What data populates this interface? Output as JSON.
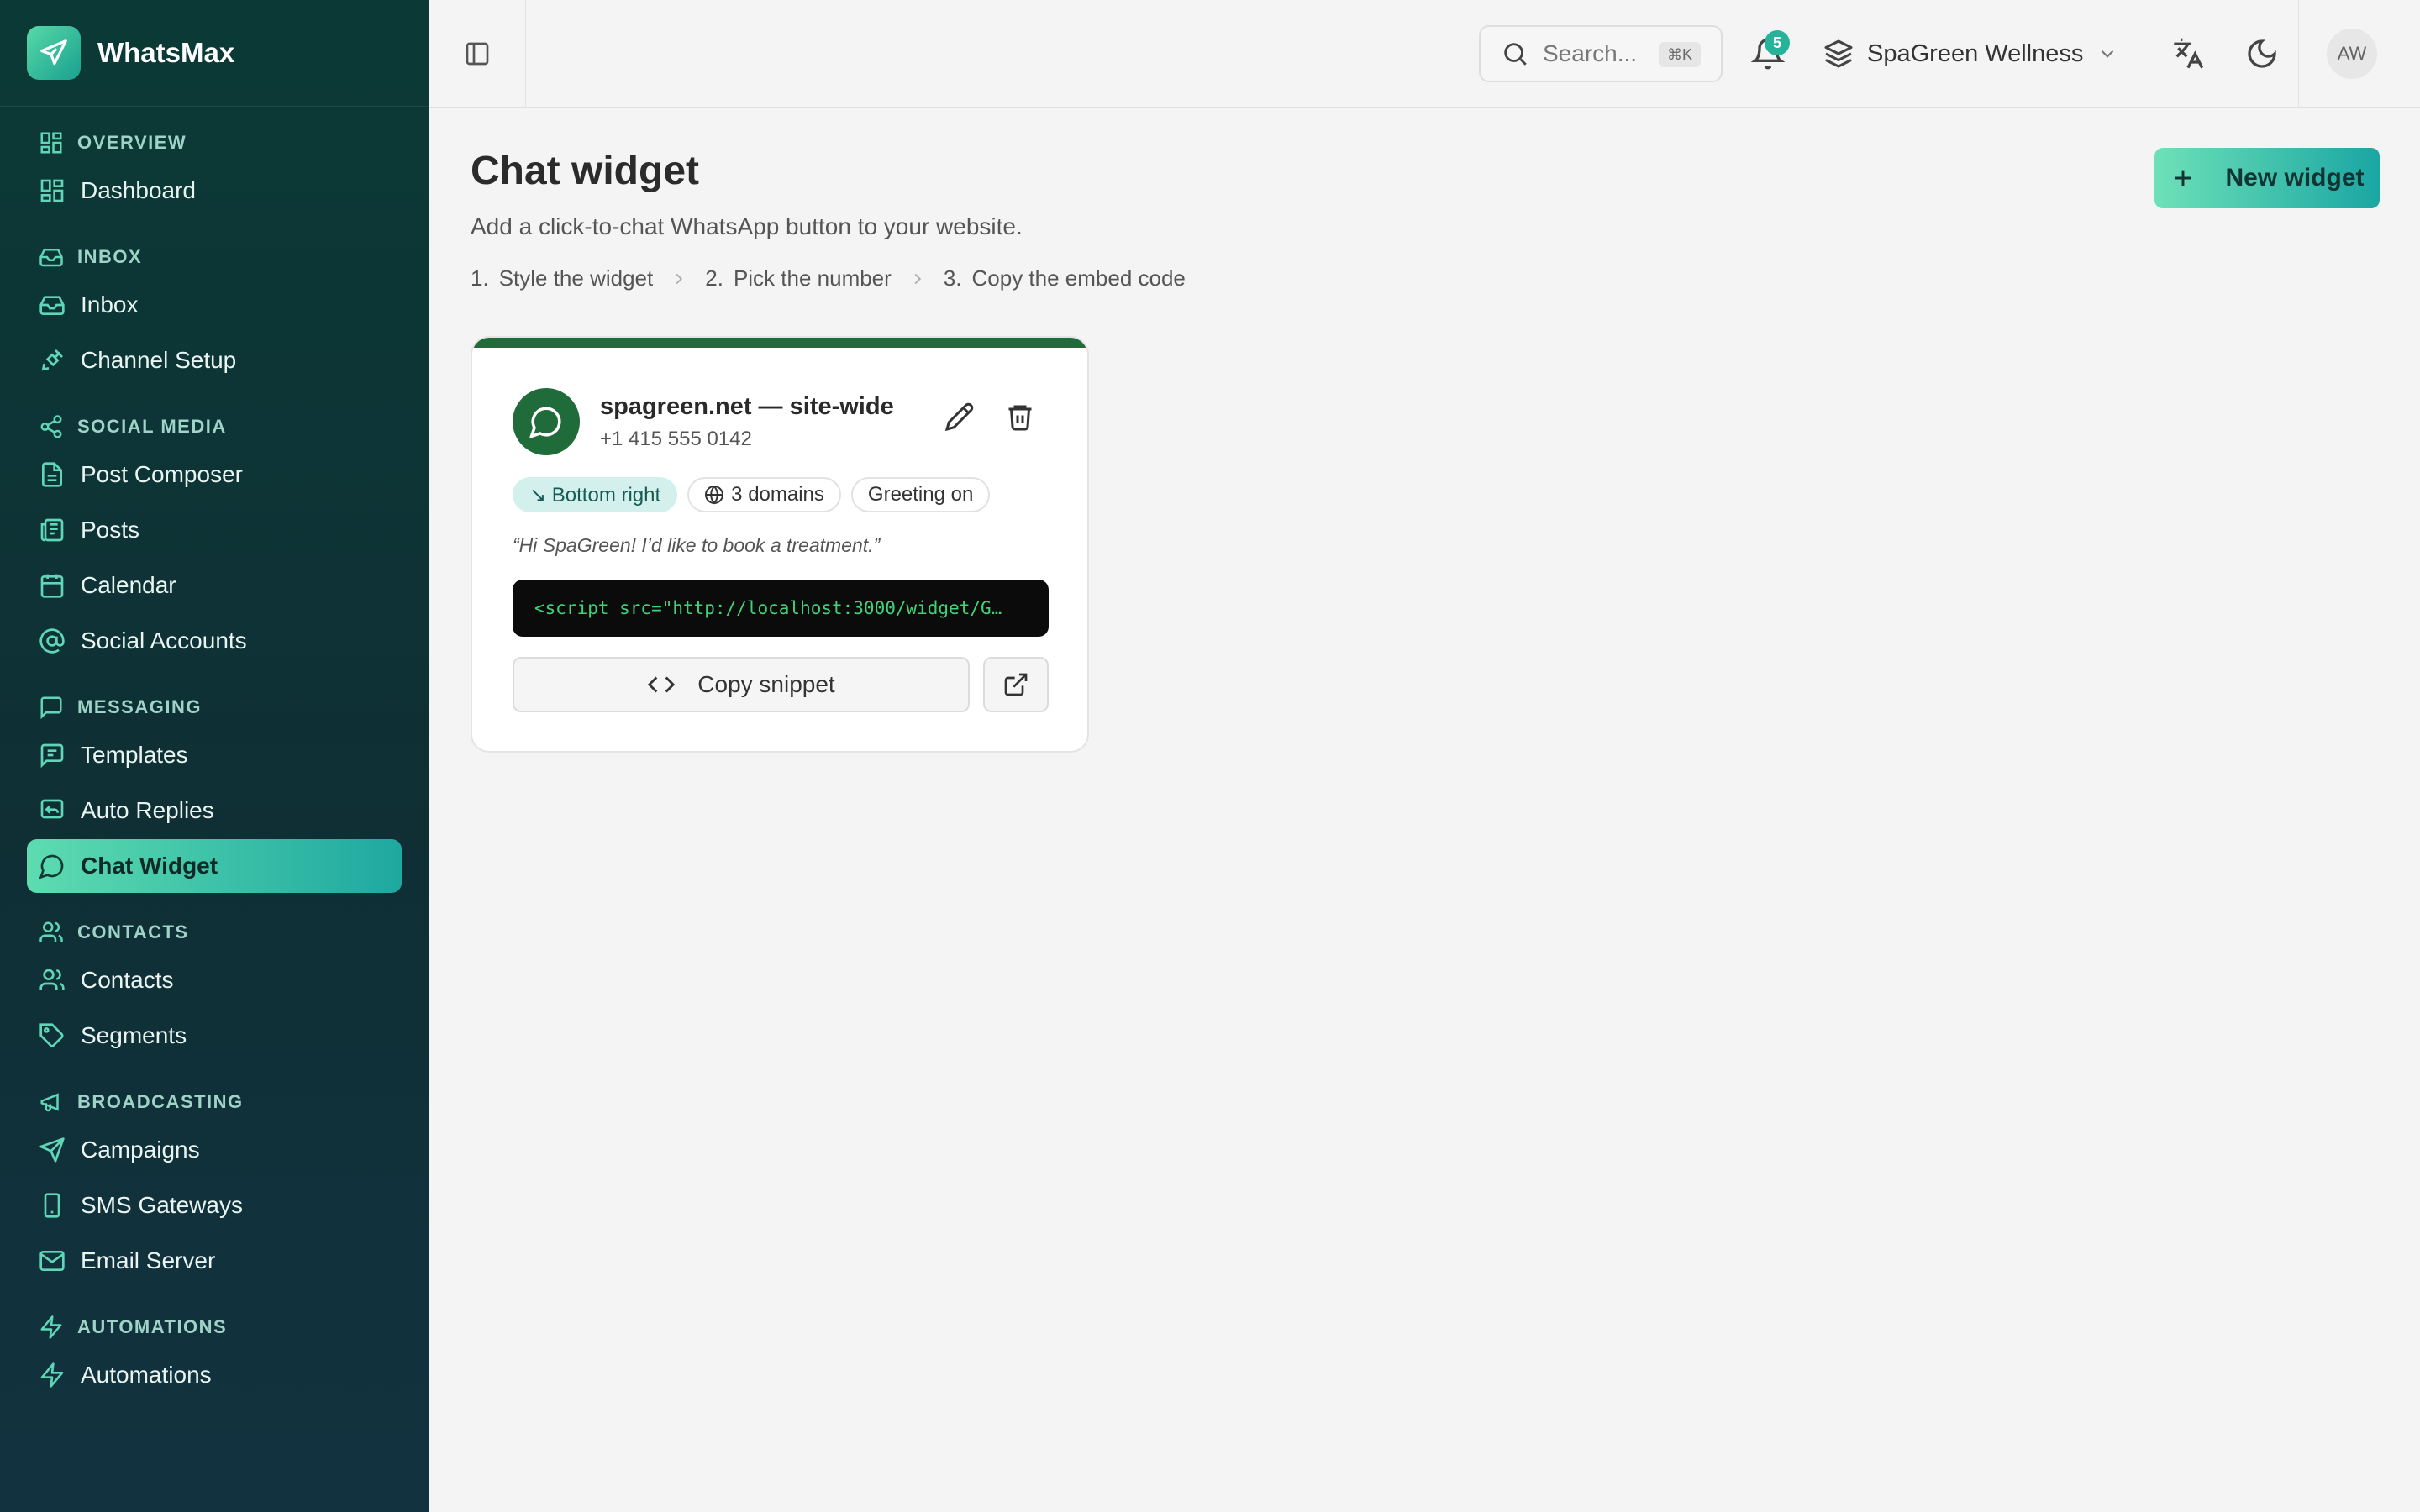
{
  "brand": {
    "name": "WhatsMax"
  },
  "sidebar": {
    "sections": [
      {
        "title": "OVERVIEW",
        "icon": "grid-icon",
        "items": [
          {
            "label": "Dashboard",
            "icon": "dashboard-icon"
          }
        ]
      },
      {
        "title": "INBOX",
        "icon": "inbox-icon",
        "items": [
          {
            "label": "Inbox",
            "icon": "inbox-icon"
          },
          {
            "label": "Channel Setup",
            "icon": "plug-icon"
          }
        ]
      },
      {
        "title": "SOCIAL MEDIA",
        "icon": "share-icon",
        "items": [
          {
            "label": "Post Composer",
            "icon": "file-icon"
          },
          {
            "label": "Posts",
            "icon": "newspaper-icon"
          },
          {
            "label": "Calendar",
            "icon": "calendar-icon"
          },
          {
            "label": "Social Accounts",
            "icon": "at-sign-icon"
          }
        ]
      },
      {
        "title": "MESSAGING",
        "icon": "message-square-icon",
        "items": [
          {
            "label": "Templates",
            "icon": "template-icon"
          },
          {
            "label": "Auto Replies",
            "icon": "reply-icon"
          },
          {
            "label": "Chat Widget",
            "icon": "chat-bubble-icon",
            "active": true
          }
        ]
      },
      {
        "title": "CONTACTS",
        "icon": "users-icon",
        "items": [
          {
            "label": "Contacts",
            "icon": "users-icon"
          },
          {
            "label": "Segments",
            "icon": "tag-icon"
          }
        ]
      },
      {
        "title": "BROADCASTING",
        "icon": "megaphone-icon",
        "items": [
          {
            "label": "Campaigns",
            "icon": "send-icon"
          },
          {
            "label": "SMS Gateways",
            "icon": "phone-icon"
          },
          {
            "label": "Email Server",
            "icon": "mail-icon"
          }
        ]
      },
      {
        "title": "AUTOMATIONS",
        "icon": "zap-icon",
        "items": [
          {
            "label": "Automations",
            "icon": "zap-icon"
          }
        ]
      }
    ]
  },
  "topbar": {
    "search_placeholder": "Search...",
    "search_shortcut": "⌘K",
    "notification_count": "5",
    "workspace": "SpaGreen Wellness",
    "avatar_initials": "AW"
  },
  "page": {
    "title": "Chat widget",
    "subtitle": "Add a click-to-chat WhatsApp button to your website.",
    "steps": [
      {
        "num": "1.",
        "label": "Style the widget"
      },
      {
        "num": "2.",
        "label": "Pick the number"
      },
      {
        "num": "3.",
        "label": "Copy the embed code"
      }
    ],
    "new_button": "New widget"
  },
  "widget_card": {
    "title": "spagreen.net — site-wide",
    "phone": "+1 415 555 0142",
    "chips": {
      "position": "↘ Bottom right",
      "domains": "3 domains",
      "greeting": "Greeting on"
    },
    "greeting_text": "“Hi SpaGreen! I’d like to book a treatment.”",
    "snippet": "<script src=\"http://localhost:3000/widget/G…",
    "copy_label": "Copy snippet",
    "accent_color": "#1f6b3a"
  },
  "colors": {
    "sidebar_bg": "#0f2f35",
    "accent": "#25b39a",
    "active_gradient_start": "#5edcb0",
    "active_gradient_end": "#1ea8a0"
  }
}
